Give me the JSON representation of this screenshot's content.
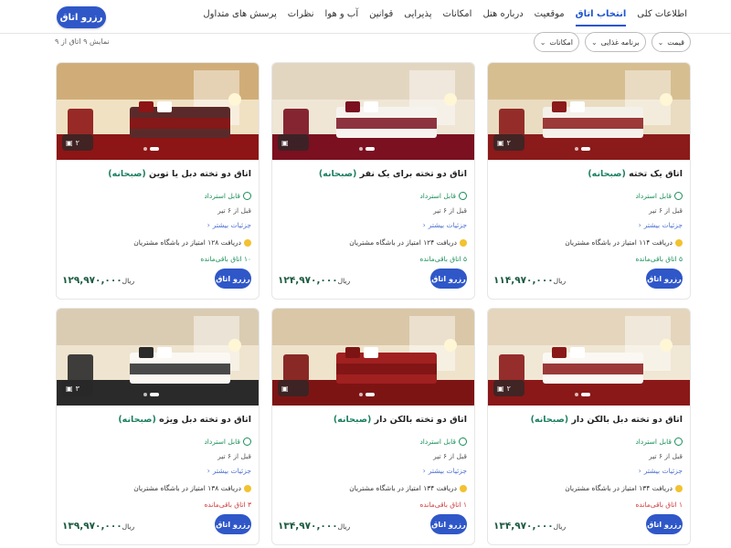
{
  "header": {
    "reserve_label": "رزرو اتاق",
    "tabs": [
      "اطلاعات کلی",
      "انتخاب اتاق",
      "موقعیت",
      "درباره هتل",
      "امکانات",
      "پذیرایی",
      "قوانین",
      "آب و هوا",
      "نظرات",
      "پرسش های متداول"
    ],
    "active_tab": "انتخاب اتاق"
  },
  "toolbar": {
    "count_text": "نمایش ۹ اتاق از ۹",
    "filters": [
      "قیمت",
      "برنامه غذایی",
      "امکانات"
    ]
  },
  "common": {
    "refund": "قابل استرداد",
    "before": "قبل از ۶ تیر",
    "details": "جزئیات بیشتر",
    "currency": "ریال",
    "reserve": "رزرو اتاق",
    "meal": "(صبحانه)"
  },
  "rooms": [
    {
      "name": "اتاق یک تخته",
      "images": "۲",
      "reward": "دریافت ۱۱۴ امتیاز در باشگاه مشتریان",
      "remaining": "۵ اتاق باقی‌مانده",
      "remaining_status": "green",
      "price": "۱۱۴,۹۷۰,۰۰۰"
    },
    {
      "name": "اتاق دو تخته برای یک نفر",
      "images": "",
      "reward": "دریافت ۱۲۴ امتیاز در باشگاه مشتریان",
      "remaining": "۵ اتاق باقی‌مانده",
      "remaining_status": "green",
      "price": "۱۲۴,۹۷۰,۰۰۰"
    },
    {
      "name": "اتاق دو تخته دبل یا توین",
      "images": "۲",
      "reward": "دریافت ۱۲۸ امتیاز در باشگاه مشتریان",
      "remaining": "۱۰ اتاق باقی‌مانده",
      "remaining_status": "green",
      "price": "۱۲۹,۹۷۰,۰۰۰"
    },
    {
      "name": "اتاق دو تخته دبل بالکن دار",
      "images": "۲",
      "reward": "دریافت ۱۳۴ امتیاز در باشگاه مشتریان",
      "remaining": "۱ اتاق باقی‌مانده",
      "remaining_status": "red",
      "price": "۱۳۴,۹۷۰,۰۰۰"
    },
    {
      "name": "اتاق دو تخته بالکن دار",
      "images": "",
      "reward": "دریافت ۱۳۴ امتیاز در باشگاه مشتریان",
      "remaining": "۱ اتاق باقی‌مانده",
      "remaining_status": "red",
      "price": "۱۳۴,۹۷۰,۰۰۰"
    },
    {
      "name": "اتاق دو تخته دبل ویژه",
      "images": "۳",
      "reward": "دریافت ۱۳۸ امتیاز در باشگاه مشتریان",
      "remaining": "۳ اتاق باقی‌مانده",
      "remaining_status": "red",
      "price": "۱۳۹,۹۷۰,۰۰۰"
    }
  ]
}
